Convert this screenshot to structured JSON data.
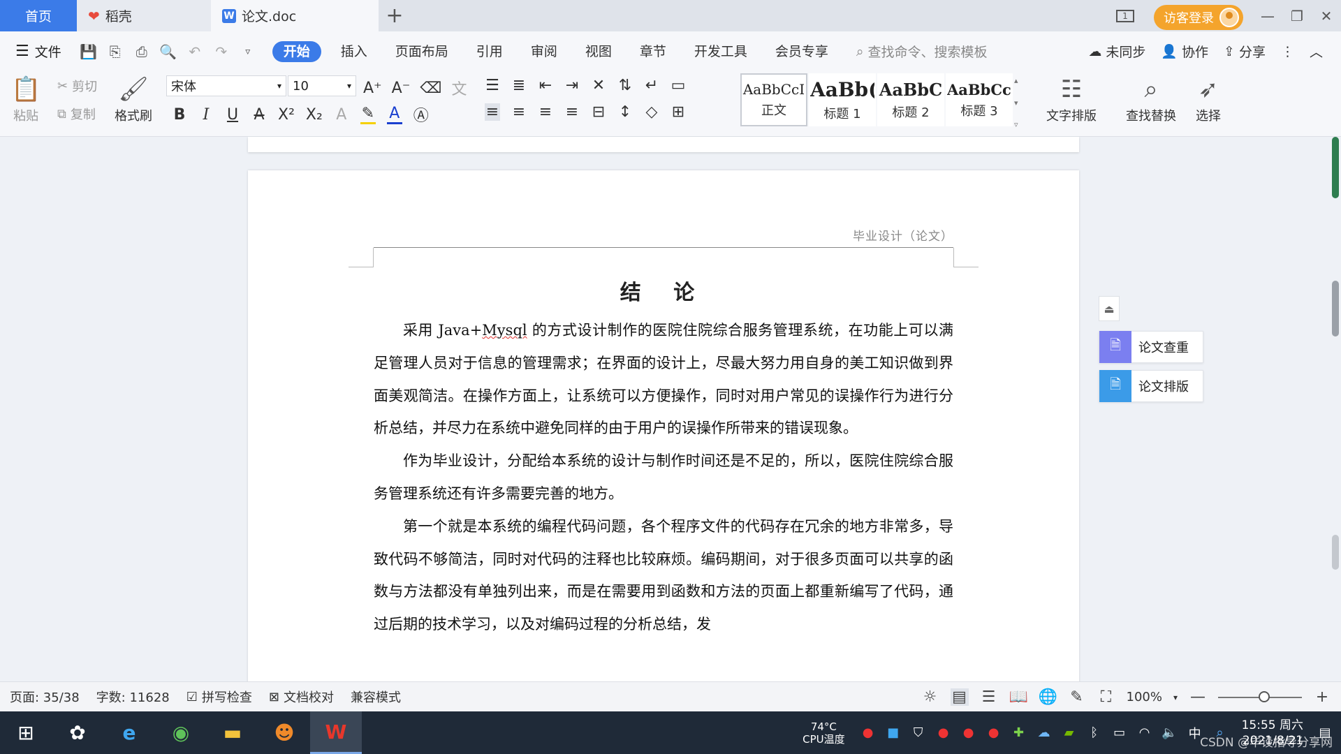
{
  "tabs": {
    "home": "首页",
    "daoke": "稻壳",
    "doc": "论文.doc",
    "add": "+"
  },
  "window": {
    "login_label": "访客登录",
    "page_indicator": "1"
  },
  "menu": {
    "file": "文件",
    "tabs": [
      "开始",
      "插入",
      "页面布局",
      "引用",
      "审阅",
      "视图",
      "章节",
      "开发工具",
      "会员专享"
    ],
    "search_placeholder": "查找命令、搜索模板",
    "sync": "未同步",
    "collab": "协作",
    "share": "分享"
  },
  "ribbon": {
    "paste": "粘贴",
    "cut": "剪切",
    "copy": "复制",
    "format_painter": "格式刷",
    "font_name": "宋体",
    "font_size": "10",
    "styles": [
      {
        "sample": "AaBbCcI",
        "label": "正文"
      },
      {
        "sample": "AaBb(",
        "label": "标题 1"
      },
      {
        "sample": "AaBbC",
        "label": "标题 2"
      },
      {
        "sample": "AaBbCcl",
        "label": "标题 3"
      }
    ],
    "text_layout": "文字排版",
    "find_replace": "查找替换",
    "select": "选择"
  },
  "document": {
    "header": "毕业设计（论文）",
    "title": "结 论",
    "para1_pre": "采用 ",
    "para1_term1": "Java",
    "para1_plus": "+",
    "para1_term2": "Mysql",
    "para1_post": " 的方式设计制作的医院住院综合服务管理系统，在功能上可以满足管理人员对于信息的管理需求；在界面的设计上，尽最大努力用自身的美工知识做到界面美观简洁。在操作方面上，让系统可以方便操作，同时对用户常见的误操作行为进行分析总结，并尽力在系统中避免同样的由于用户的误操作所带来的错误现象。",
    "para2": "作为毕业设计，分配给本系统的设计与制作时间还是不足的，所以，医院住院综合服务管理系统还有许多需要完善的地方。",
    "para3": "第一个就是本系统的编程代码问题，各个程序文件的代码存在冗余的地方非常多，导致代码不够简洁，同时对代码的注释也比较麻烦。编码期间，对于很多页面可以共享的函数与方法都没有单独列出来，而是在需要用到函数和方法的页面上都重新编写了代码，通过后期的技术学习，以及对编码过程的分析总结，发"
  },
  "side_panel": {
    "check": "论文查重",
    "format": "论文排版"
  },
  "status": {
    "page": "页面: 35/38",
    "words": "字数: 11628",
    "spell": "拼写检查",
    "proof": "文档校对",
    "compat": "兼容模式",
    "zoom": "100%",
    "zoom_level": 0.55
  },
  "taskbar": {
    "cpu_temp": "74°C",
    "cpu_label": "CPU温度",
    "time": "15:55 周六",
    "date": "2021/8/21",
    "ime": "中",
    "watermark": "CSDN @毕设指导分享网"
  },
  "colors": {
    "accent": "#3b7be8",
    "login": "#f4a42c",
    "taskbar": "#1f2a38"
  }
}
